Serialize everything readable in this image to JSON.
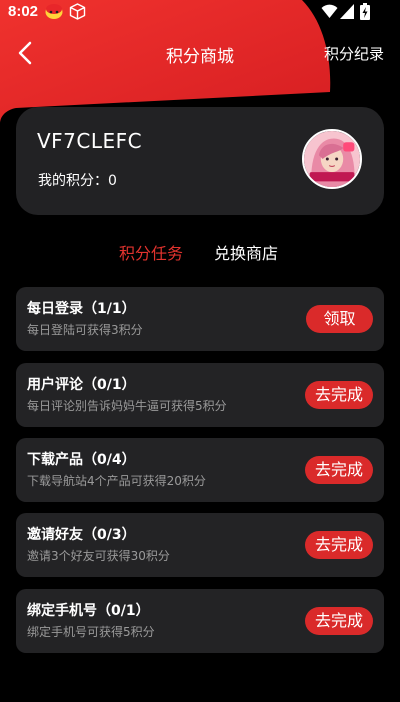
{
  "status_bar": {
    "time": "8:02",
    "icons": [
      "app-notification-icon",
      "cube-icon",
      "wifi-icon",
      "cell-signal-icon",
      "battery-icon"
    ]
  },
  "header": {
    "back_icon": "chevron-left-icon",
    "title": "积分商城",
    "right_link": "积分纪录"
  },
  "user_card": {
    "username": "VF7CLEFC",
    "points_label": "我的积分：",
    "points_value": "0",
    "avatar": "avatar-icon"
  },
  "tabs": [
    {
      "label": "积分任务",
      "active": true
    },
    {
      "label": "兑换商店",
      "active": false
    }
  ],
  "tasks": [
    {
      "title": "每日登录（1/1）",
      "description": "每日登陆可获得3积分",
      "button": "领取"
    },
    {
      "title": "用户评论（0/1）",
      "description": "每日评论别告诉妈妈牛逼可获得5积分",
      "button": "去完成"
    },
    {
      "title": "下载产品（0/4）",
      "description": "下载导航站4个产品可获得20积分",
      "button": "去完成"
    },
    {
      "title": "邀请好友（0/3）",
      "description": "邀请3个好友可获得30积分",
      "button": "去完成"
    },
    {
      "title": "绑定手机号（0/1）",
      "description": "绑定手机号可获得5积分",
      "button": "去完成"
    }
  ],
  "colors": {
    "background": "#000000",
    "accent_red": "#e2332e",
    "button_red": "#da2a2a",
    "card": "#232325",
    "muted_text": "#9a9a9a"
  }
}
